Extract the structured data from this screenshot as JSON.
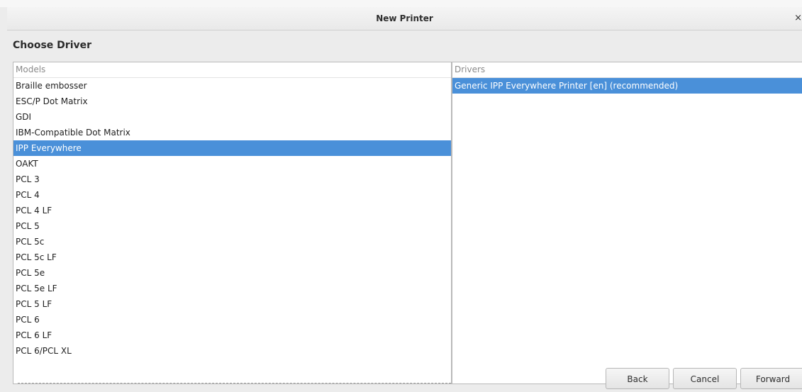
{
  "window": {
    "title": "New Printer",
    "close_glyph": "×"
  },
  "heading": "Choose Driver",
  "models": {
    "header": "Models",
    "items": [
      "Braille embosser",
      "ESC/P Dot Matrix",
      "GDI",
      "IBM-Compatible Dot Matrix",
      "IPP Everywhere",
      "OAKT",
      "PCL 3",
      "PCL 4",
      "PCL 4 LF",
      "PCL 5",
      "PCL 5c",
      "PCL 5c LF",
      "PCL 5e",
      "PCL 5e LF",
      "PCL 5 LF",
      "PCL 6",
      "PCL 6 LF",
      "PCL 6/PCL XL"
    ],
    "selected": "IPP Everywhere"
  },
  "drivers": {
    "header": "Drivers",
    "items": [
      "Generic IPP Everywhere Printer [en] (recommended)"
    ],
    "selected": "Generic IPP Everywhere Printer [en] (recommended)"
  },
  "buttons": {
    "back": "Back",
    "cancel": "Cancel",
    "forward": "Forward"
  },
  "colors": {
    "selection": "#4a90d9",
    "header_text": "#8a8a8a"
  }
}
